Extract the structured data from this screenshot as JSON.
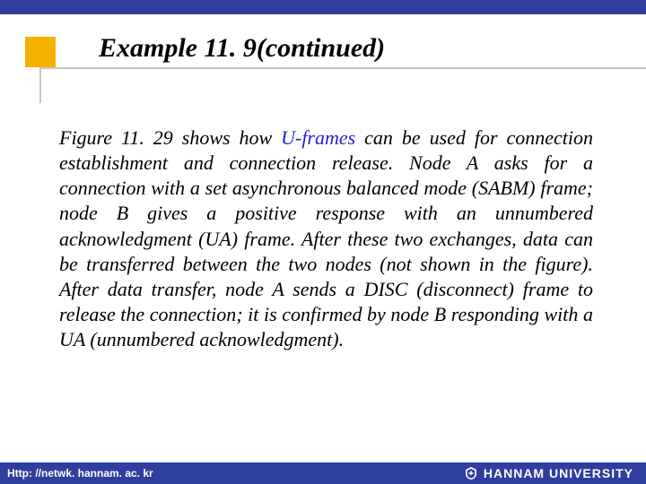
{
  "title": "Example 11. 9(continued)",
  "body": {
    "pre_key": "Figure 11. 29 shows how ",
    "key": "U-frames",
    "post_key": " can be used for connection establishment and connection release. Node A asks for a connection with a set asynchronous balanced mode (SABM) frame; node B gives a positive response with an unnumbered acknowledgment (UA) frame. After these two exchanges, data can be transferred between the two nodes (not shown in the figure). After data transfer, node A sends a DISC (disconnect) frame to release the connection; it is confirmed by node B responding with a UA (unnumbered acknowledgment)."
  },
  "footer": {
    "url": "Http: //netwk. hannam. ac. kr",
    "university": "HANNAM  UNIVERSITY"
  },
  "colors": {
    "accent_bar": "#2f3e9e",
    "accent_square": "#f4b200",
    "keyword": "#1f1fe0"
  }
}
